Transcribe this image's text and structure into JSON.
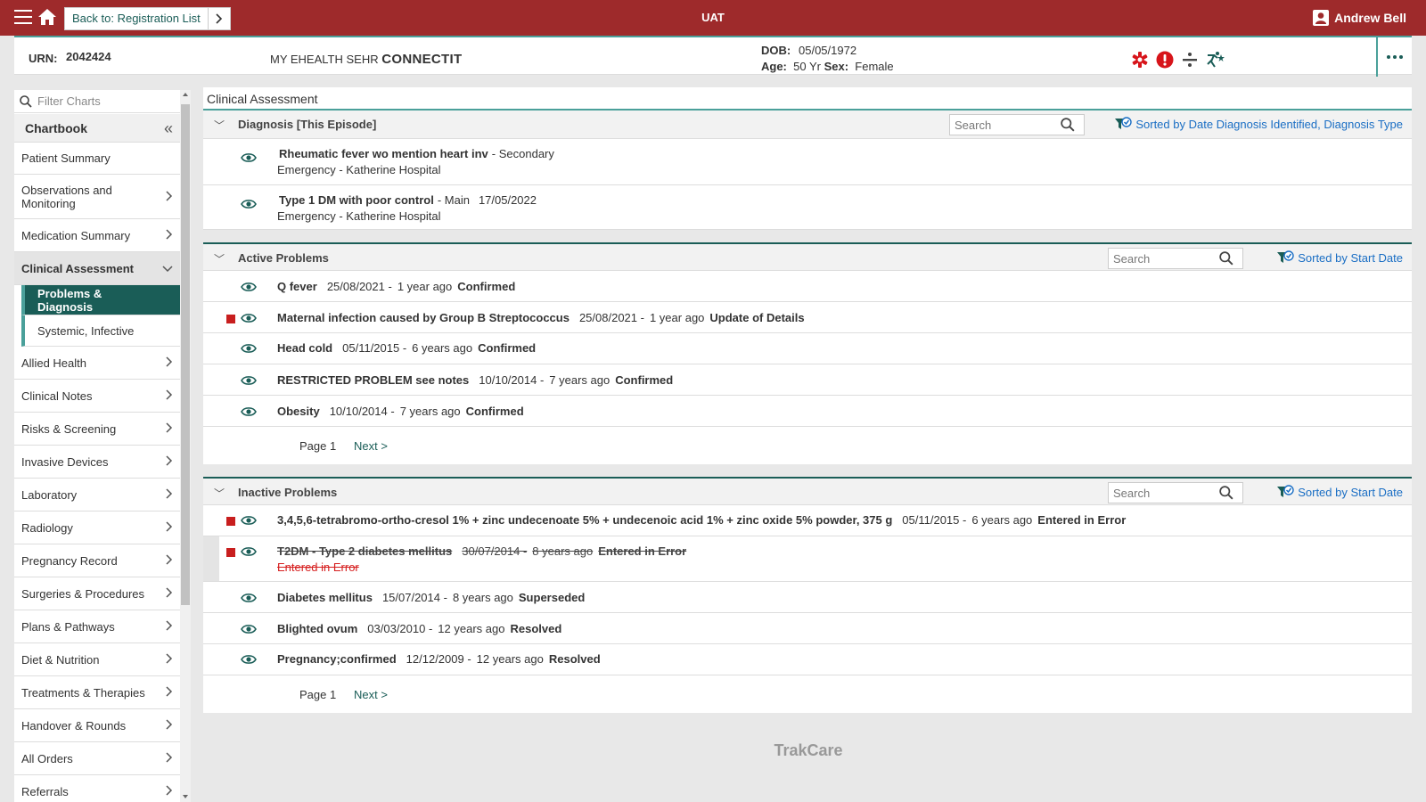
{
  "topbar": {
    "back_label": "Back to: Registration List",
    "environment": "UAT",
    "user_name": "Andrew Bell"
  },
  "banner": {
    "urn_label": "URN:",
    "urn": "2042424",
    "ehealth_prefix": "MY EHEALTH SEHR",
    "ehealth_name": "CONNECTIT",
    "dob_label": "DOB:",
    "dob": "05/05/1972",
    "age_label": "Age:",
    "age": "50 Yr",
    "sex_label": "Sex:",
    "sex": "Female",
    "alert_icons": [
      "medical-star-icon",
      "alert-icon",
      "divide-icon",
      "running-person-icon"
    ],
    "colors": {
      "alert": "#d7141a",
      "teal": "#1a5d57"
    }
  },
  "sidebar": {
    "filter_placeholder": "Filter Charts",
    "chartbook_title": "Chartbook",
    "items": [
      {
        "label": "Patient Summary",
        "chevron": false
      },
      {
        "label": "Observations and Monitoring",
        "chevron": true
      },
      {
        "label": "Medication Summary",
        "chevron": true
      },
      {
        "label": "Clinical Assessment",
        "chevron": true,
        "expanded": true
      },
      {
        "label": "Problems & Diagnosis",
        "sub": true,
        "selected": true
      },
      {
        "label": "Systemic, Infective",
        "sub": true
      },
      {
        "label": "Allied Health",
        "chevron": true
      },
      {
        "label": "Clinical Notes",
        "chevron": true
      },
      {
        "label": "Risks & Screening",
        "chevron": true
      },
      {
        "label": "Invasive Devices",
        "chevron": true
      },
      {
        "label": "Laboratory",
        "chevron": true
      },
      {
        "label": "Radiology",
        "chevron": true
      },
      {
        "label": "Pregnancy Record",
        "chevron": true
      },
      {
        "label": "Surgeries & Procedures",
        "chevron": true
      },
      {
        "label": "Plans & Pathways",
        "chevron": true
      },
      {
        "label": "Diet & Nutrition",
        "chevron": true
      },
      {
        "label": "Treatments & Therapies",
        "chevron": true
      },
      {
        "label": "Handover & Rounds",
        "chevron": true
      },
      {
        "label": "All Orders",
        "chevron": true
      },
      {
        "label": "Referrals",
        "chevron": true
      }
    ]
  },
  "main": {
    "panel_title": "Clinical Assessment",
    "diagnosis": {
      "title": "Diagnosis [This Episode]",
      "search_placeholder": "Search",
      "sort_label": "Sorted by Date Diagnosis Identified, Diagnosis Type",
      "rows": [
        {
          "name": "Rheumatic fever wo mention heart inv",
          "type": "- Secondary",
          "date": "",
          "line2": "Emergency  - Katherine Hospital"
        },
        {
          "name": "Type 1 DM with poor control",
          "type": "- Main",
          "date": "17/05/2022",
          "line2": "Emergency  - Katherine Hospital"
        }
      ]
    },
    "active": {
      "title": "Active Problems",
      "search_placeholder": "Search",
      "sort_label": "Sorted by Start Date",
      "rows": [
        {
          "name": "Q fever",
          "date": "25/08/2021 -",
          "ago": "1 year ago",
          "status": "Confirmed",
          "flag": false
        },
        {
          "name": "Maternal infection caused by Group B Streptococcus",
          "date": "25/08/2021 -",
          "ago": "1 year ago",
          "status": "Update of Details",
          "flag": true
        },
        {
          "name": "Head cold",
          "date": "05/11/2015 -",
          "ago": "6 years ago",
          "status": "Confirmed",
          "flag": false
        },
        {
          "name": "RESTRICTED PROBLEM see notes",
          "date": "10/10/2014 -",
          "ago": "7 years ago",
          "status": "Confirmed",
          "flag": false
        },
        {
          "name": "Obesity",
          "date": "10/10/2014 -",
          "ago": "7 years ago",
          "status": "Confirmed",
          "flag": false
        }
      ],
      "page_label": "Page  1",
      "next_label": "Next >"
    },
    "inactive": {
      "title": "Inactive Problems",
      "search_placeholder": "Search",
      "sort_label": "Sorted by Start Date",
      "rows": [
        {
          "name": "3,4,5,6-tetrabromo-ortho-cresol 1% + zinc undecenoate 5% + undecenoic acid 1% + zinc oxide 5% powder, 375 g",
          "date": "05/11/2015 -",
          "ago": "6 years ago",
          "status": "Entered in Error",
          "flag": true,
          "struck": false
        },
        {
          "name": "T2DM - Type 2 diabetes mellitus",
          "date": "30/07/2014 -",
          "ago": "8 years ago",
          "status": "Entered in Error",
          "flag": true,
          "struck": true,
          "line2": "Entered in Error"
        },
        {
          "name": "Diabetes mellitus",
          "date": "15/07/2014 -",
          "ago": "8 years ago",
          "status": "Superseded",
          "flag": false,
          "struck": false
        },
        {
          "name": "Blighted ovum",
          "date": "03/03/2010 -",
          "ago": "12 years ago",
          "status": "Resolved",
          "flag": false,
          "struck": false
        },
        {
          "name": "Pregnancy;confirmed",
          "date": "12/12/2009 -",
          "ago": "12 years ago",
          "status": "Resolved",
          "flag": false,
          "struck": false
        }
      ],
      "page_label": "Page  1",
      "next_label": "Next >"
    }
  },
  "footer": {
    "brand": "TrakCare"
  }
}
